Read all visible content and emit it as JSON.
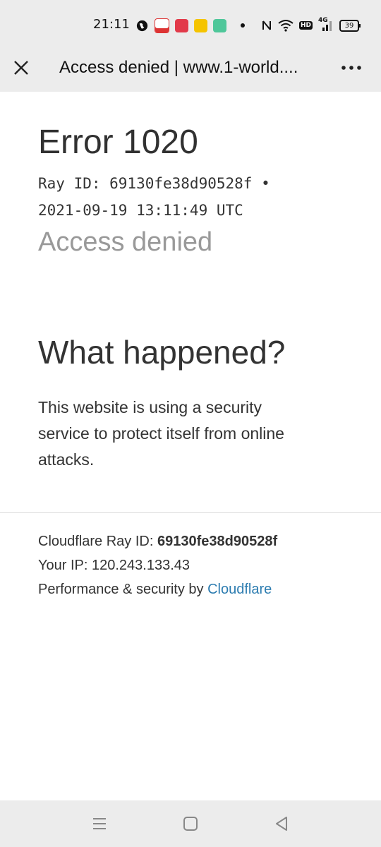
{
  "status_bar": {
    "time": "21:11",
    "network": "4G",
    "battery": "39",
    "hd": "HD"
  },
  "toolbar": {
    "title": "Access denied | www.1-world....",
    "close_icon": "close-icon",
    "more_icon": "more-vert-icon"
  },
  "error": {
    "title": "Error 1020",
    "ray_line_1": "Ray ID: 69130fe38d90528f •",
    "ray_line_2": "2021-09-19 13:11:49 UTC",
    "subtitle": "Access denied"
  },
  "what_happened": {
    "heading": "What happened?",
    "lines": [
      "This website is using a security",
      "service to protect itself from online",
      "attacks."
    ]
  },
  "footer": {
    "ray_label": "Cloudflare Ray ID: ",
    "ray_id": "69130fe38d90528f",
    "ip_label": "Your IP: ",
    "ip": "120.243.133.43",
    "perf_label": "Performance & security by ",
    "cf_link": "Cloudflare"
  },
  "colors": {
    "link": "#2c7cb0",
    "muted": "#999999",
    "bar": "#ececec"
  }
}
